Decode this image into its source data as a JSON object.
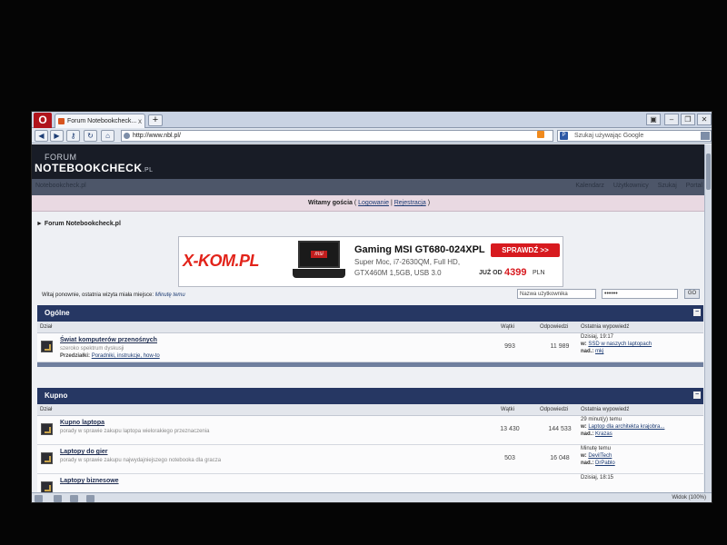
{
  "browser": {
    "opera_label": "O",
    "tab_title": "Forum Notebookcheck...",
    "tab_close": "x",
    "newtab_label": "+",
    "url": "http://www.nbl.pl/",
    "search_placeholder": "Szukaj używając Google",
    "search_engine_label": "P",
    "status_zoom": "Widok (100%)"
  },
  "header": {
    "logo_small": "FORUM",
    "logo_big": "NOTEBOOKCHECK",
    "logo_suffix": ".PL"
  },
  "navstrip": {
    "breadcrumb": "Notebookcheck.pl",
    "links": [
      "Kalendarz",
      "Użytkownicy",
      "Szukaj",
      "Portal"
    ]
  },
  "welcome": {
    "prefix": "Witamy gościa",
    "open": " ( ",
    "login": "Logowanie",
    "sep": " | ",
    "register": "Rejestracja",
    "close": " )"
  },
  "breadcrumb2": "► Forum Notebookcheck.pl",
  "ad": {
    "brand_a": "X-KOM",
    "brand_b": ".PL",
    "laptop_badge": "msi",
    "title": "Gaming MSI GT680-024XPL",
    "specs": "Super Moc, i7-2630QM, Full HD, GTX460M 1,5GB, USB 3.0",
    "cta": "SPRAWDŹ >>",
    "from": "JUŻ OD",
    "price": "4399",
    "currency": "PLN"
  },
  "lastvisit": {
    "text": "Witaj ponownie, ostatnia wizyta miała miejsce:",
    "time": "Minutę temu"
  },
  "login": {
    "user_placeholder": "Nazwa użytkownika",
    "password_value": "••••••",
    "go_label": "GO"
  },
  "categories": [
    {
      "title": "Ogólne",
      "collapse": "−",
      "cols": {
        "forum": "Dział",
        "topics": "Wątki",
        "posts": "Odpowiedzi",
        "last": "Ostatnia wypowiedź"
      },
      "rows": [
        {
          "name": "Świat komputerów przenośnych",
          "desc": "szeroko spektrum dyskusji",
          "mods_label": "Przedziałki:",
          "mods": "Poradniki, instrukcje, how-to",
          "topics": "993",
          "posts": "11 989",
          "last_time": "Dzisiaj, 19:17",
          "last_prefix": "w:",
          "last_thread": "SSD w naszych laptopach",
          "last_by_label": "nad.:",
          "last_by": "mkj"
        }
      ]
    },
    {
      "title": "Kupno",
      "collapse": "−",
      "cols": {
        "forum": "Dział",
        "topics": "Wątki",
        "posts": "Odpowiedzi",
        "last": "Ostatnia wypowiedź"
      },
      "rows": [
        {
          "name": "Kupno laptopa",
          "desc": "porady w sprawie zakupu laptopa wielorakiego przeznaczenia",
          "topics": "13 430",
          "posts": "144 533",
          "last_time": "29 minut(y) temu",
          "last_prefix": "w:",
          "last_thread": "Laptop dla architekta krajobra...",
          "last_by_label": "nad.:",
          "last_by": "Krazas"
        },
        {
          "name": "Laptopy do gier",
          "desc": "porady w sprawie zakupu najwydajniejszego notebooka dla gracza",
          "topics": "503",
          "posts": "16 048",
          "last_time": "Minutę temu",
          "last_prefix": "w:",
          "last_thread": "DevilTech",
          "last_by_label": "nad.:",
          "last_by": "DrPablo"
        },
        {
          "name": "Laptopy biznesowe",
          "desc": "",
          "topics": "",
          "posts": "",
          "last_time": "Dzisiaj, 18:15",
          "last_prefix": "",
          "last_thread": "",
          "last_by_label": "",
          "last_by": ""
        }
      ]
    }
  ]
}
